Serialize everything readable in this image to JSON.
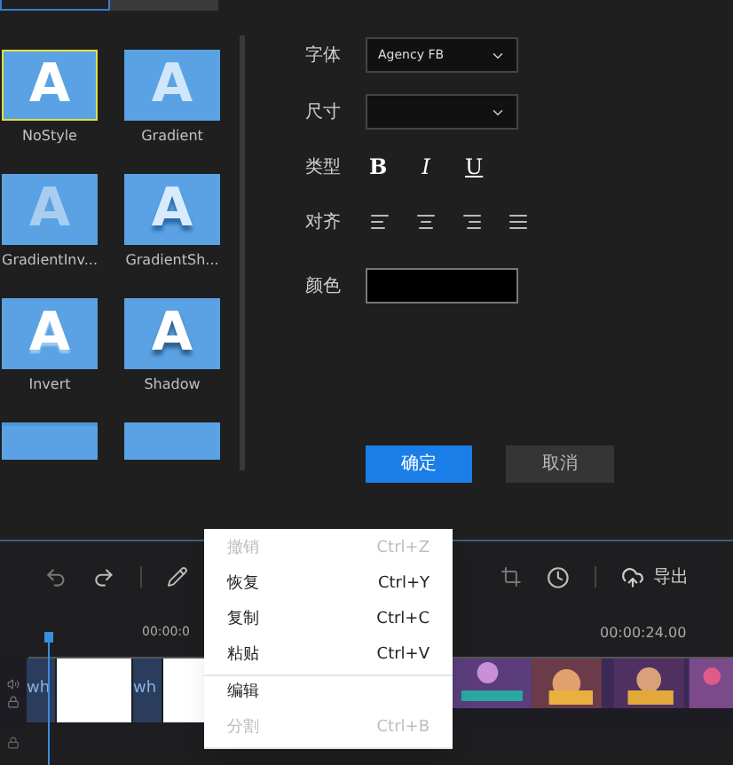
{
  "style_tabs": [
    {
      "selected": true
    },
    {
      "selected": false
    }
  ],
  "styles": [
    {
      "sample": "A",
      "label": "NoStyle",
      "kind": "plain",
      "selected": true
    },
    {
      "sample": "A",
      "label": "Gradient",
      "kind": "gradient",
      "selected": false
    },
    {
      "sample": "A",
      "label": "GradientInv...",
      "kind": "gradient_inverse",
      "selected": false
    },
    {
      "sample": "A",
      "label": "GradientSh...",
      "kind": "gradient_shadow",
      "selected": false
    },
    {
      "sample": "A",
      "label": "Invert",
      "kind": "invert",
      "selected": false
    },
    {
      "sample": "A",
      "label": "Shadow",
      "kind": "shadow",
      "selected": false
    },
    {
      "kind": "outline",
      "selected": false
    },
    {
      "kind": "plain",
      "selected": false
    }
  ],
  "settings": {
    "font": {
      "label": "字体",
      "value": "Agency FB"
    },
    "size": {
      "label": "尺寸"
    },
    "type": {
      "label": "类型",
      "buttons": [
        {
          "text": "B",
          "kind": "bold"
        },
        {
          "text": "I",
          "kind": "italic"
        },
        {
          "text": "U",
          "kind": "underline"
        }
      ]
    },
    "align": {
      "label": "对齐",
      "options": [
        {
          "kind": "left"
        },
        {
          "kind": "center"
        },
        {
          "kind": "right"
        },
        {
          "kind": "justify"
        }
      ]
    },
    "color": {
      "label": "颜色",
      "color": "#000000"
    }
  },
  "buttons": {
    "confirm": "确定",
    "cancel": "取消"
  },
  "toolbar": {
    "export": "导出"
  },
  "ruler": {
    "timecodes": [
      "00:00:0",
      "00:00:24.00"
    ]
  },
  "track": {
    "clips": [
      {
        "kind": "title",
        "text": "wh"
      },
      {
        "kind": "blank"
      },
      {
        "kind": "title",
        "text": "wh"
      },
      {
        "kind": "blank"
      },
      {
        "kind": "video"
      }
    ]
  },
  "context_menu": [
    {
      "label": "撤销",
      "shortcut": "Ctrl+Z",
      "disabled": true,
      "divider_after": false
    },
    {
      "label": "恢复",
      "shortcut": "Ctrl+Y",
      "disabled": false,
      "divider_after": false
    },
    {
      "label": "复制",
      "shortcut": "Ctrl+C",
      "disabled": false,
      "divider_after": false
    },
    {
      "label": "粘贴",
      "shortcut": "Ctrl+V",
      "disabled": false,
      "divider_after": true
    },
    {
      "label": "编辑",
      "disabled": false,
      "divider_after": false
    },
    {
      "label": "分割",
      "shortcut": "Ctrl+B",
      "disabled": true,
      "divider_after": true
    }
  ]
}
